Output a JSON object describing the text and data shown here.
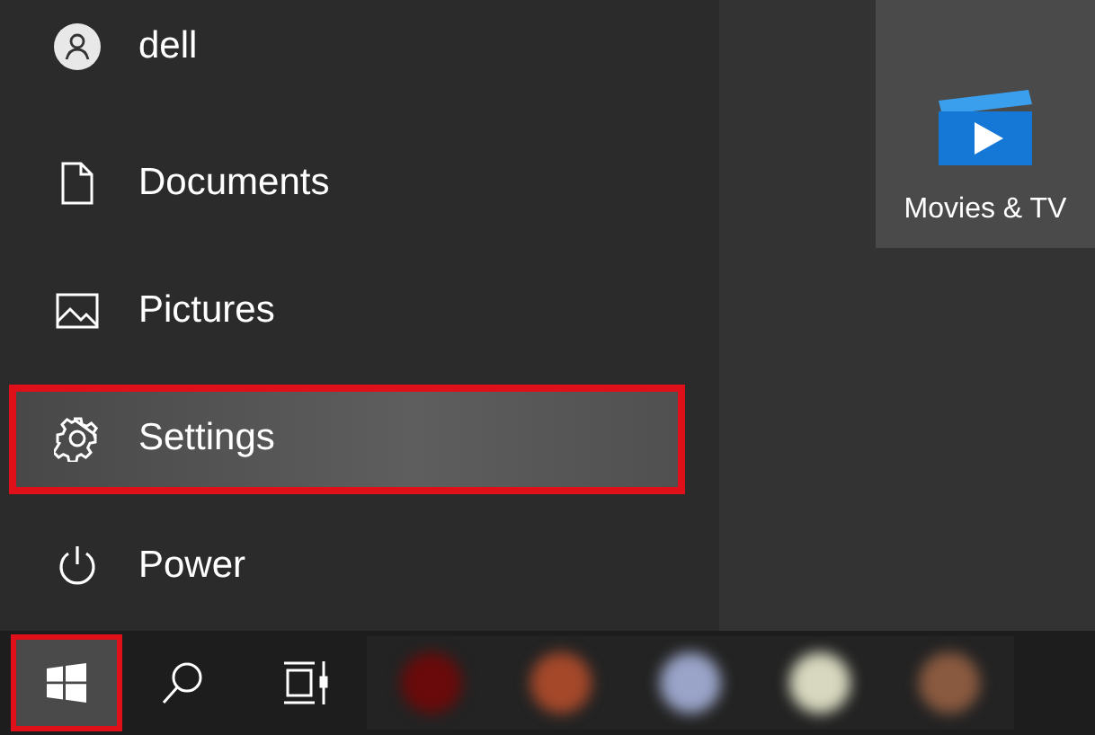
{
  "menu_items": [
    {
      "kind": "user",
      "label": "dell",
      "highlighted": false
    },
    {
      "kind": "documents",
      "label": "Documents",
      "highlighted": false
    },
    {
      "kind": "pictures",
      "label": "Pictures",
      "highlighted": false
    },
    {
      "kind": "settings",
      "label": "Settings",
      "highlighted": true
    },
    {
      "kind": "power",
      "label": "Power",
      "highlighted": false
    }
  ],
  "tile": {
    "label": "Movies & TV"
  },
  "taskbar": {
    "start_highlighted": true,
    "apps": [
      {
        "color": "#6a0a0a"
      },
      {
        "color": "#a5482a"
      },
      {
        "color": "#9aa4c8"
      },
      {
        "color": "#d8d8c0"
      },
      {
        "color": "#8a5a40"
      }
    ]
  }
}
